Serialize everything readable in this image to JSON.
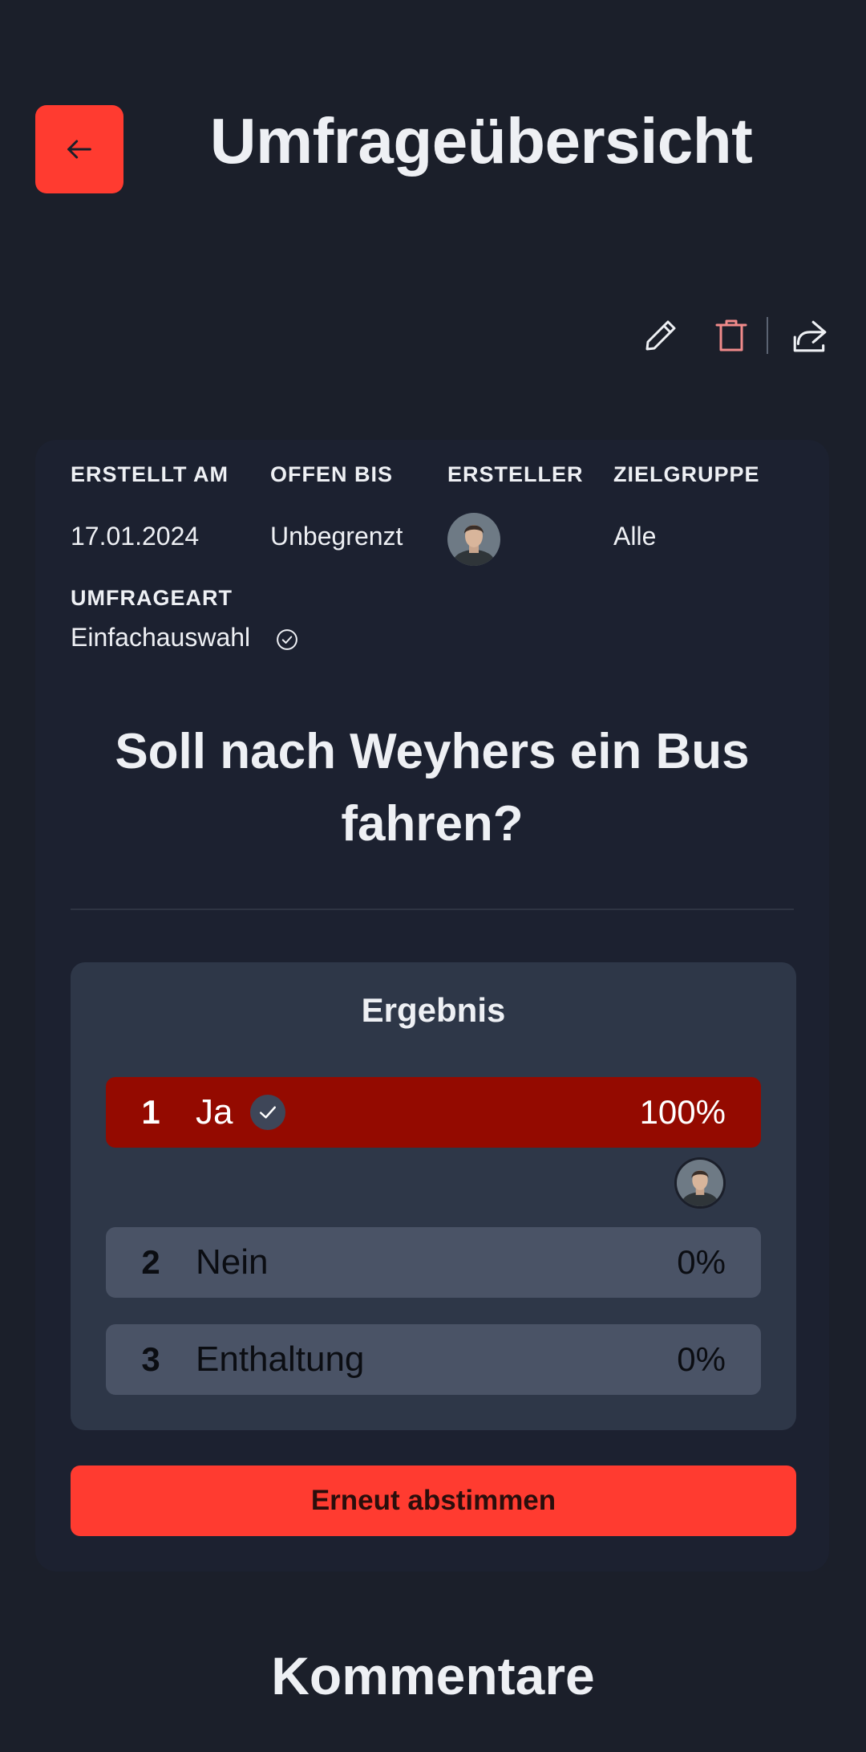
{
  "header": {
    "title": "Umfrageübersicht",
    "back_icon": "arrow-left-icon"
  },
  "toolbar": {
    "edit_icon": "pencil-icon",
    "delete_icon": "trash-icon",
    "share_icon": "share-icon"
  },
  "meta": {
    "created_label": "ERSTELLT AM",
    "created_value": "17.01.2024",
    "open_until_label": "OFFEN BIS",
    "open_until_value": "Unbegrenzt",
    "creator_label": "ERSTELLER",
    "target_group_label": "ZIELGRUPPE",
    "target_group_value": "Alle",
    "poll_type_label": "UMFRAGEART",
    "poll_type_value": "Einfachauswahl"
  },
  "question": "Soll nach Weyhers ein Bus fahren?",
  "results": {
    "title": "Ergebnis",
    "options": [
      {
        "number": "1",
        "label": "Ja",
        "percent": "100%",
        "voted": true
      },
      {
        "number": "2",
        "label": "Nein",
        "percent": "0%",
        "voted": false
      },
      {
        "number": "3",
        "label": "Enthaltung",
        "percent": "0%",
        "voted": false
      }
    ]
  },
  "revote_button": "Erneut abstimmen",
  "comments_title": "Kommentare",
  "colors": {
    "background": "#1b1f2a",
    "accent": "#ff3b30",
    "winner": "#940a00",
    "option": "#4a5366",
    "result_box": "#2e3748"
  }
}
